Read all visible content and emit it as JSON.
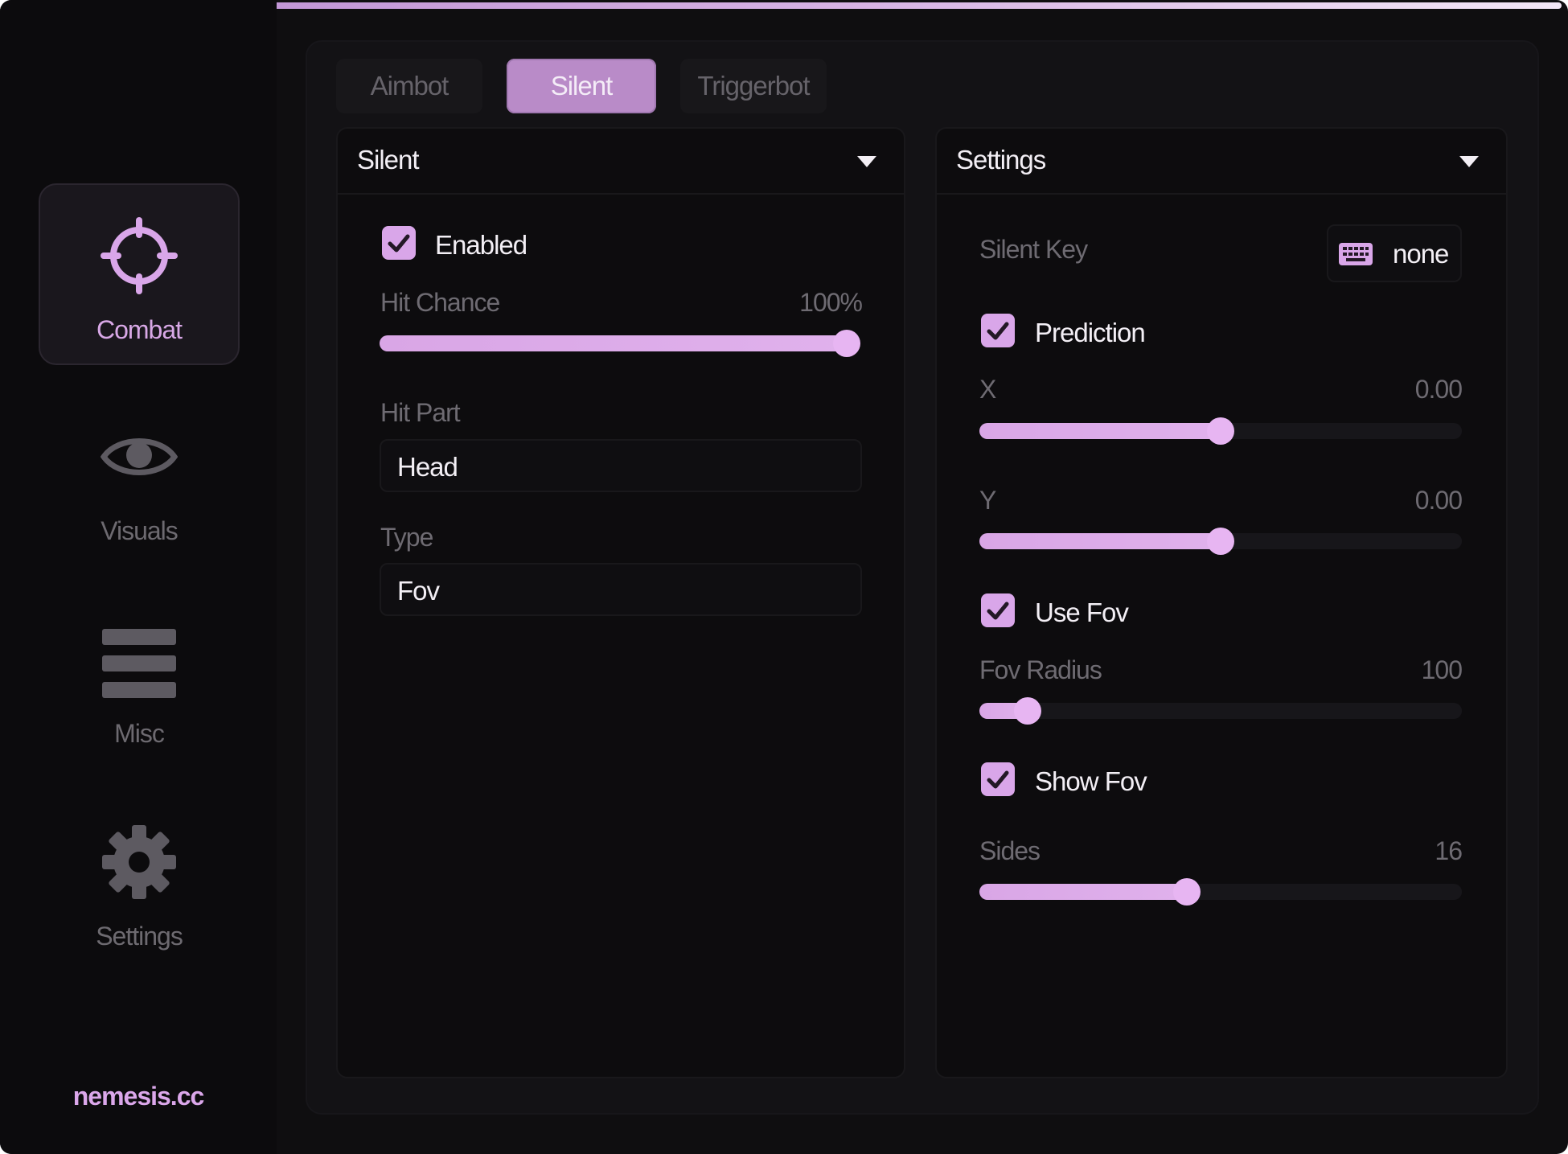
{
  "brand": "nemesis.cc",
  "sidebar": {
    "items": [
      {
        "label": "Combat",
        "icon": "crosshair-icon",
        "active": true
      },
      {
        "label": "Visuals",
        "icon": "eye-icon",
        "active": false
      },
      {
        "label": "Misc",
        "icon": "menu-icon",
        "active": false
      },
      {
        "label": "Settings",
        "icon": "gear-icon",
        "active": false
      }
    ]
  },
  "tabs": [
    {
      "label": "Aimbot",
      "active": false
    },
    {
      "label": "Silent",
      "active": true
    },
    {
      "label": "Triggerbot",
      "active": false
    }
  ],
  "silent_section": {
    "title": "Silent",
    "enabled_label": "Enabled",
    "enabled": true,
    "hit_chance": {
      "label": "Hit Chance",
      "value_text": "100%",
      "level": 1.0
    },
    "hit_part": {
      "label": "Hit Part",
      "value": "Head"
    },
    "type": {
      "label": "Type",
      "value": "Fov"
    }
  },
  "settings_section": {
    "title": "Settings",
    "silent_key": {
      "label": "Silent Key",
      "value": "none",
      "icon": "keyboard-icon"
    },
    "prediction": {
      "label": "Prediction",
      "checked": true
    },
    "x": {
      "label": "X",
      "value_text": "0.00",
      "level": 0.5
    },
    "y": {
      "label": "Y",
      "value_text": "0.00",
      "level": 0.5
    },
    "use_fov": {
      "label": "Use Fov",
      "checked": true
    },
    "fov_radius": {
      "label": "Fov Radius",
      "value_text": "100",
      "level": 0.1
    },
    "show_fov": {
      "label": "Show Fov",
      "checked": true
    },
    "sides": {
      "label": "Sides",
      "value_text": "16",
      "level": 0.43
    }
  },
  "colors": {
    "accent": "#d9a6e9",
    "tab_active": "#b98bc8",
    "background": "#0f0e10"
  }
}
